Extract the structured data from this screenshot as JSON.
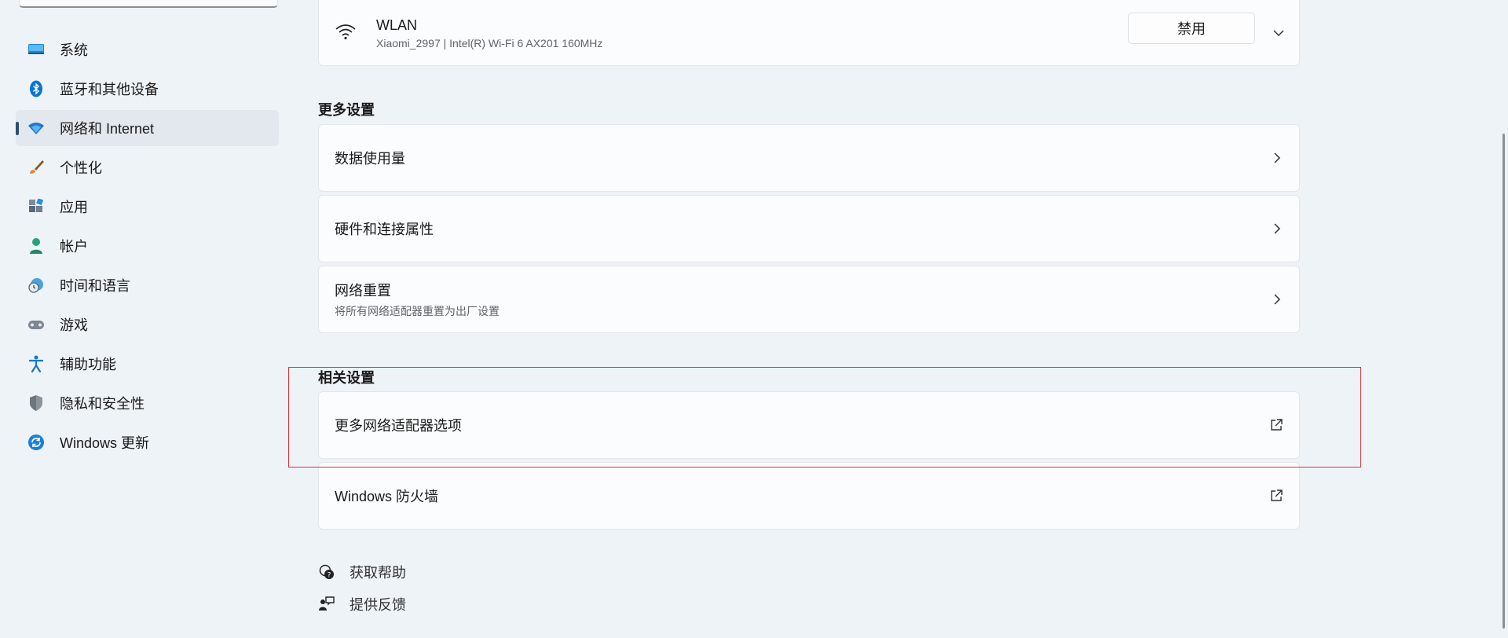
{
  "sidebar": {
    "items": [
      {
        "label": "系统",
        "icon": "system-icon"
      },
      {
        "label": "蓝牙和其他设备",
        "icon": "bluetooth-icon"
      },
      {
        "label": "网络和 Internet",
        "icon": "wifi-icon",
        "active": true
      },
      {
        "label": "个性化",
        "icon": "brush-icon"
      },
      {
        "label": "应用",
        "icon": "apps-icon"
      },
      {
        "label": "帐户",
        "icon": "account-icon"
      },
      {
        "label": "时间和语言",
        "icon": "globe-clock-icon"
      },
      {
        "label": "游戏",
        "icon": "gamepad-icon"
      },
      {
        "label": "辅助功能",
        "icon": "accessibility-icon"
      },
      {
        "label": "隐私和安全性",
        "icon": "shield-icon"
      },
      {
        "label": "Windows 更新",
        "icon": "update-icon"
      }
    ]
  },
  "wlan": {
    "title": "WLAN",
    "subtitle": "Xiaomi_2997 | Intel(R) Wi-Fi 6 AX201 160MHz",
    "disable_label": "禁用"
  },
  "more_settings": {
    "heading": "更多设置",
    "items": [
      {
        "title": "数据使用量"
      },
      {
        "title": "硬件和连接属性"
      },
      {
        "title": "网络重置",
        "subtitle": "将所有网络适配器重置为出厂设置"
      }
    ]
  },
  "related_settings": {
    "heading": "相关设置",
    "items": [
      {
        "title": "更多网络适配器选项"
      },
      {
        "title": "Windows 防火墙"
      }
    ]
  },
  "help": {
    "get_help": "获取帮助",
    "feedback": "提供反馈"
  },
  "colors": {
    "accent": "#0067c0",
    "highlight_box": "#e03030",
    "background": "#eef3f8"
  }
}
